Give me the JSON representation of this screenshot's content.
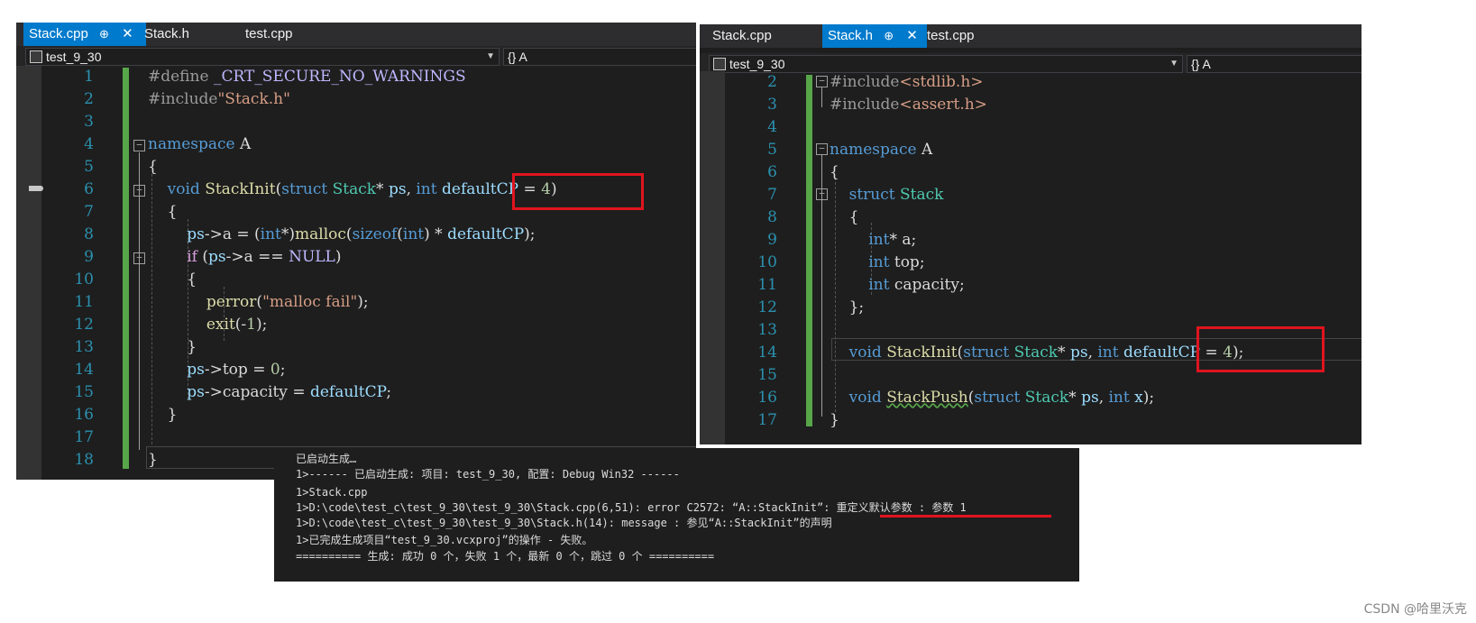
{
  "left_editor": {
    "tabs": [
      {
        "label": "Stack.cpp",
        "active": true,
        "pin": "⊕",
        "close": "✕"
      },
      {
        "label": "Stack.h",
        "active": false
      },
      {
        "label": "test.cpp",
        "active": false
      }
    ],
    "nav_project": "test_9_30",
    "nav_scope": "{} A",
    "line_numbers": [
      "1",
      "2",
      "3",
      "4",
      "5",
      "6",
      "7",
      "8",
      "9",
      "10",
      "11",
      "12",
      "13",
      "14",
      "15",
      "16",
      "17",
      "18"
    ]
  },
  "right_editor": {
    "tabs": [
      {
        "label": "Stack.cpp",
        "active": false
      },
      {
        "label": "Stack.h",
        "active": true,
        "pin": "⊕",
        "close": "✕"
      },
      {
        "label": "test.cpp",
        "active": false
      }
    ],
    "nav_project": "test_9_30",
    "nav_scope": "{} A",
    "line_numbers": [
      "2",
      "3",
      "4",
      "5",
      "6",
      "7",
      "8",
      "9",
      "10",
      "11",
      "12",
      "13",
      "14",
      "15",
      "16",
      "17"
    ]
  },
  "output": {
    "lines": [
      "已启动生成…",
      "1>------ 已启动生成: 项目: test_9_30, 配置: Debug Win32 ------",
      "1>Stack.cpp",
      "1>D:\\code\\test_c\\test_9_30\\test_9_30\\Stack.cpp(6,51): error C2572: “A::StackInit”: 重定义默认参数 : 参数 1",
      "1>D:\\code\\test_c\\test_9_30\\test_9_30\\Stack.h(14): message : 参见“A::StackInit”的声明",
      "1>已完成生成项目“test_9_30.vcxproj”的操作 - 失败。",
      "========== 生成: 成功 0 个，失败 1 个，最新 0 个，跳过 0 个 =========="
    ]
  },
  "watermark": "CSDN @哈里沃克",
  "colors": {
    "accent_tab": "#007acc",
    "error_highlight": "#e0141e",
    "editor_bg": "#1e1e1e"
  }
}
